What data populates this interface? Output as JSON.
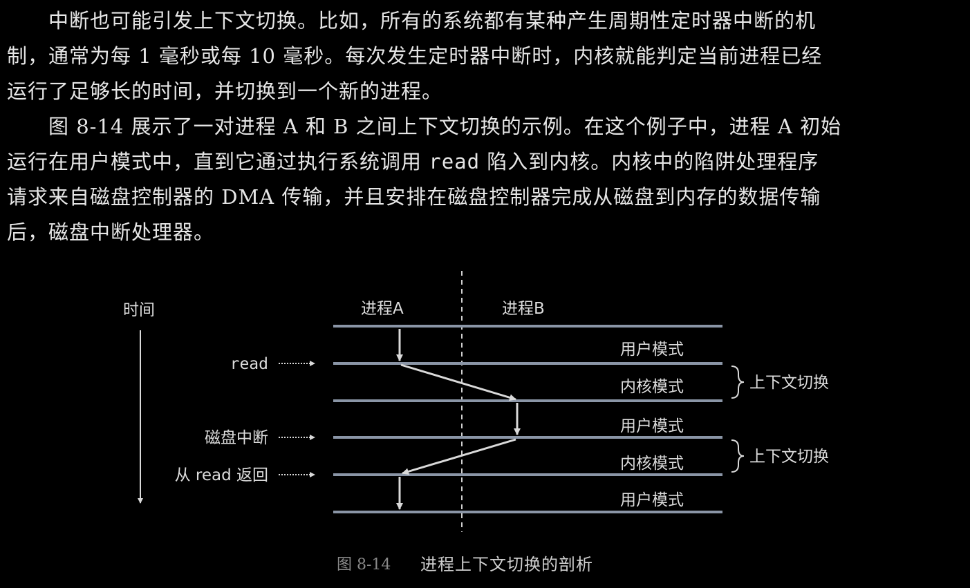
{
  "paragraphs": [
    {
      "id": "p1",
      "lines": [
        "中断也可能引发上下文切换。比如，所有的系统都有某种产生周期性定时器中断的机",
        "制，通常为每 1 毫秒或每 10 毫秒。每次发生定时器中断时，内核就能判定当前进程已经",
        "运行了足够长的时间，并切换到一个新的进程。"
      ]
    },
    {
      "id": "p2",
      "lines": [
        "图 8-14 展示了一对进程 A 和 B 之间上下文切换的示例。在这个例子中，进程 A 初始",
        "运行在用户模式中，直到它通过执行系统调用 ",
        "read",
        " 陷入到内核。内核中的陷阱处理程序",
        "请求来自磁盘控制器的 DMA 传输，并且安排在磁盘控制器完成从磁盘到内存的数据传输",
        "后，磁盘中断处理器。"
      ]
    }
  ],
  "figure": {
    "time_label": "时间",
    "process_a": "进程A",
    "process_b": "进程B",
    "events": [
      "read",
      "磁盘中断",
      "从 read 返回"
    ],
    "modes": [
      "用户模式",
      "内核模式",
      "用户模式",
      "内核模式",
      "用户模式"
    ],
    "context_switch_label": "上下文切换",
    "caption_number": "图 8-14",
    "caption_text": "进程上下文切换的剖析"
  },
  "colors": {
    "background": "#000000",
    "text": "#e6e6e6",
    "line": "#8a95a6",
    "arrow": "#d9d9d9"
  }
}
